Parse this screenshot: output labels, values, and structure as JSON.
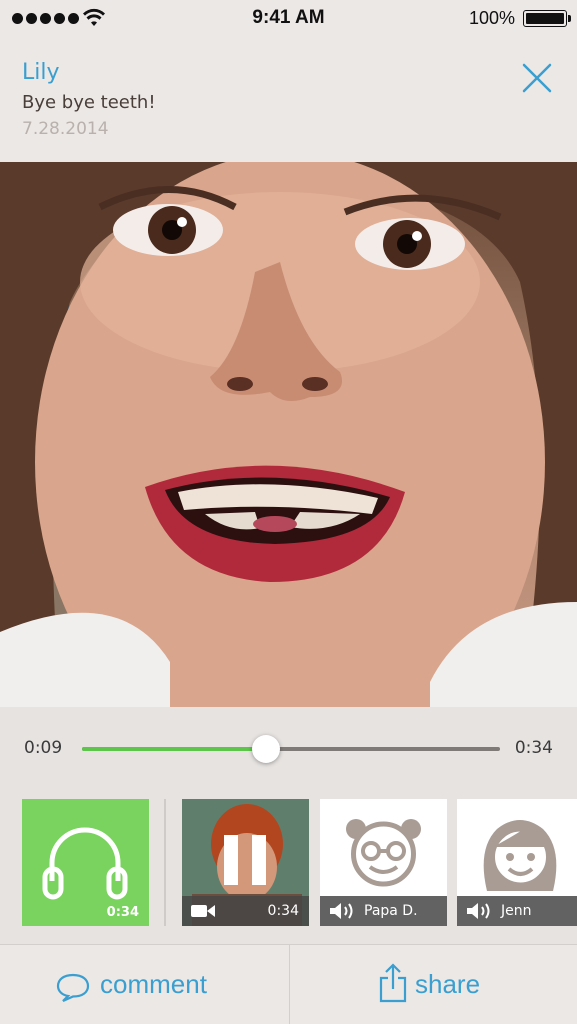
{
  "status_bar": {
    "time": "9:41 AM",
    "battery": "100%"
  },
  "header": {
    "name": "Lily",
    "title": "Bye bye teeth!",
    "date": "7.28.2014"
  },
  "player": {
    "elapsed": "0:09",
    "total": "0:34",
    "progress": 0.44
  },
  "reactions": [
    {
      "kind": "listen",
      "duration": "0:34",
      "icon": "headphones-icon"
    },
    {
      "kind": "video",
      "duration": "0:34",
      "icon": "video-camera-icon"
    },
    {
      "kind": "audio",
      "label": "Papa D.",
      "icon": "speaker-icon",
      "avatar": "grandpa-avatar"
    },
    {
      "kind": "audio",
      "label": "Jenn",
      "icon": "speaker-icon",
      "avatar": "girl-avatar"
    }
  ],
  "actions": {
    "comment": "comment",
    "share": "share"
  },
  "colors": {
    "accent": "#3a9fd0",
    "progress": "#5dc54a",
    "listen_tile": "#79d35e"
  }
}
